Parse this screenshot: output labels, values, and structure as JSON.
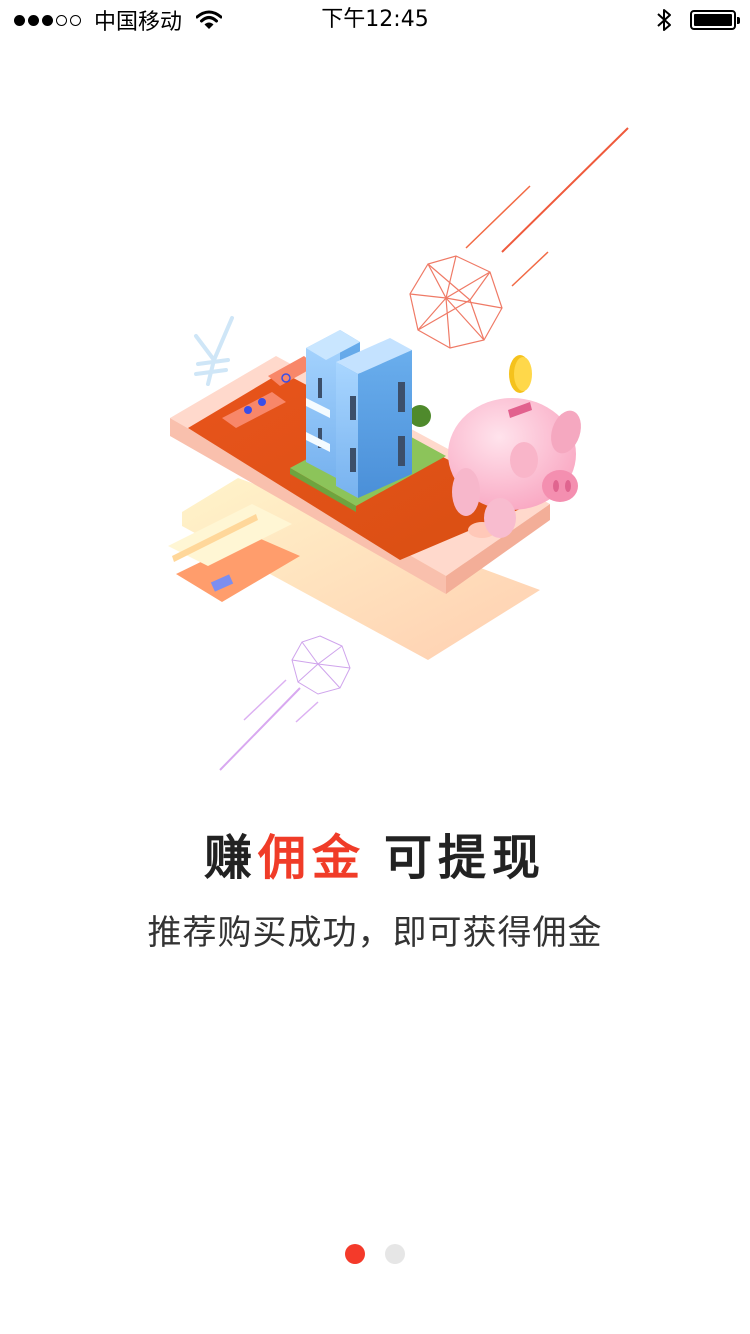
{
  "status_bar": {
    "carrier": "中国移动",
    "time": "下午12:45",
    "signal_bars_filled": 3,
    "signal_bars_total": 5,
    "battery_level": 1.0
  },
  "onboarding": {
    "headline_prefix": "赚",
    "headline_accent": "佣金",
    "headline_suffix": "可提现",
    "subtitle": "推荐购买成功，即可获得佣金",
    "accent_color": "#f03c28"
  },
  "pager": {
    "total_pages": 2,
    "current_page": 1,
    "active_color": "#f43a2a",
    "inactive_color": "#e6e6e6"
  }
}
